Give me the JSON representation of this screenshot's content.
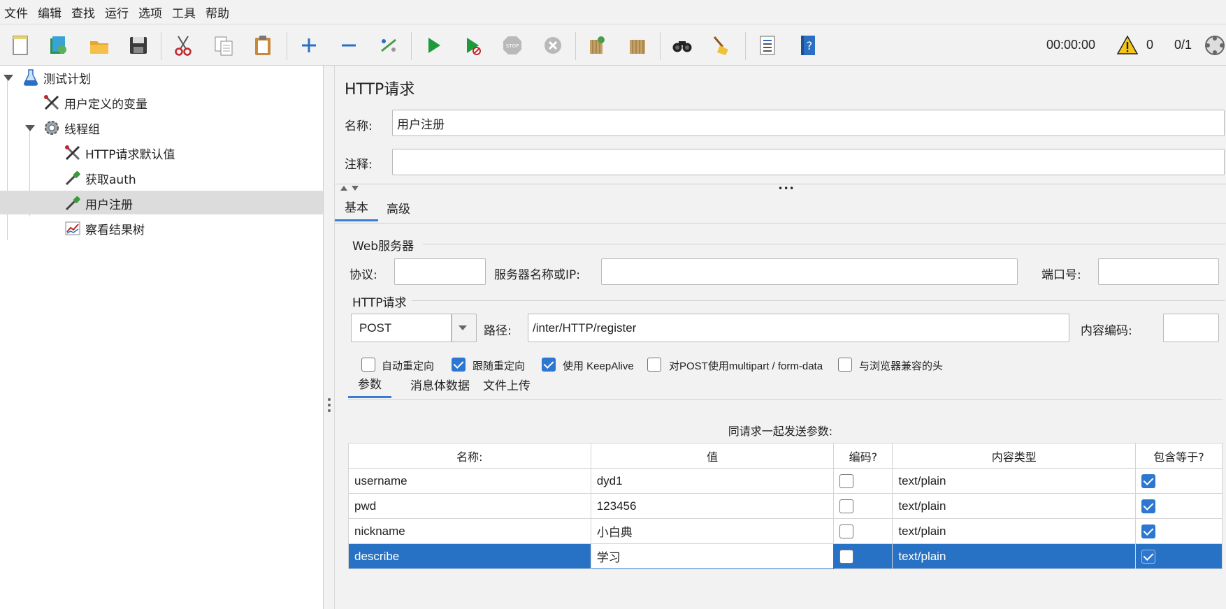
{
  "menubar": {
    "items": [
      "文件",
      "编辑",
      "查找",
      "运行",
      "选项",
      "工具",
      "帮助"
    ]
  },
  "toolbar": {
    "timer": "00:00:00",
    "warnings": "0",
    "threads": "0/1"
  },
  "tree": {
    "items": [
      {
        "label": "测试计划",
        "icon": "flask-icon"
      },
      {
        "label": "用户定义的变量",
        "icon": "tools-icon"
      },
      {
        "label": "线程组",
        "icon": "gear-icon"
      },
      {
        "label": "HTTP请求默认值",
        "icon": "tools-icon"
      },
      {
        "label": "获取auth",
        "icon": "pipette-icon"
      },
      {
        "label": "用户注册",
        "icon": "pipette-icon"
      },
      {
        "label": "察看结果树",
        "icon": "chart-icon"
      }
    ]
  },
  "panel": {
    "title": "HTTP请求",
    "name_label": "名称:",
    "name_value": "用户注册",
    "comment_label": "注释:",
    "comment_value": "",
    "tabs": [
      "基本",
      "高级"
    ],
    "web_server": {
      "group_title": "Web服务器",
      "protocol_label": "协议:",
      "server_label": "服务器名称或IP:",
      "port_label": "端口号:"
    },
    "http_request": {
      "group_title": "HTTP请求",
      "method": "POST",
      "path_label": "路径:",
      "path_value": "/inter/HTTP/register",
      "encoding_label": "内容编码:"
    },
    "options": [
      {
        "label": "自动重定向",
        "checked": false
      },
      {
        "label": "跟随重定向",
        "checked": true
      },
      {
        "label": "使用 KeepAlive",
        "checked": true
      },
      {
        "label": "对POST使用multipart / form-data",
        "checked": false
      },
      {
        "label": "与浏览器兼容的头",
        "checked": false
      }
    ],
    "sub_tabs": [
      "参数",
      "消息体数据",
      "文件上传"
    ],
    "params_caption": "同请求一起发送参数:",
    "params_headers": [
      "名称:",
      "值",
      "编码?",
      "内容类型",
      "包含等于?"
    ],
    "params": [
      {
        "name": "username",
        "value": "dyd1",
        "encode": false,
        "content_type": "text/plain",
        "include_equals": true
      },
      {
        "name": "pwd",
        "value": "123456",
        "encode": false,
        "content_type": "text/plain",
        "include_equals": true
      },
      {
        "name": "nickname",
        "value": "小白典",
        "encode": false,
        "content_type": "text/plain",
        "include_equals": true
      },
      {
        "name": "describe",
        "value": "学习",
        "encode": false,
        "content_type": "text/plain",
        "include_equals": true
      }
    ]
  },
  "colors": {
    "accent": "#2872c5",
    "selection_row": "#2872c5",
    "tree_selected": "#dcdcdc"
  }
}
